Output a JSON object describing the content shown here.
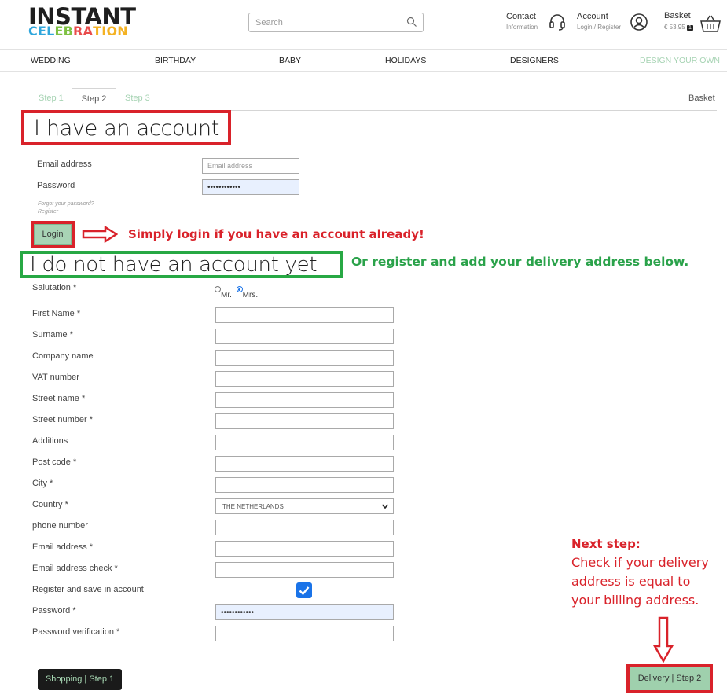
{
  "brand": {
    "line1": "INSTANT",
    "line2_letters": [
      {
        "ch": "C",
        "color": "#2fa6dc"
      },
      {
        "ch": "E",
        "color": "#2fa6dc"
      },
      {
        "ch": "L",
        "color": "#2fa6dc"
      },
      {
        "ch": "E",
        "color": "#7ec142"
      },
      {
        "ch": "B",
        "color": "#7ec142"
      },
      {
        "ch": "R",
        "color": "#e94b4b"
      },
      {
        "ch": "A",
        "color": "#e94b4b"
      },
      {
        "ch": "T",
        "color": "#f4b223"
      },
      {
        "ch": "I",
        "color": "#f4b223"
      },
      {
        "ch": "O",
        "color": "#f4b223"
      },
      {
        "ch": "N",
        "color": "#f4b223"
      }
    ]
  },
  "search": {
    "placeholder": "Search"
  },
  "header": {
    "contact_label": "Contact",
    "contact_sub": "Information",
    "account_label": "Account",
    "account_sub": "Login / Register",
    "basket_label": "Basket",
    "basket_amount": "€ 53,95",
    "basket_count": "1"
  },
  "nav": [
    "WEDDING",
    "BIRTHDAY",
    "BABY",
    "HOLIDAYS",
    "DESIGNERS",
    "DESIGN YOUR OWN"
  ],
  "steps": {
    "step1": "Step 1",
    "step2": "Step 2",
    "step3": "Step 3",
    "basket": "Basket"
  },
  "login_section": {
    "heading": "I have an account",
    "email_label": "Email address",
    "email_placeholder": "Email address",
    "password_label": "Password",
    "password_value": "••••••••••••",
    "forgot": "Forgot your password?",
    "register": "Register",
    "login_button": "Login"
  },
  "annotations": {
    "login_note": "Simply login if you have an account already!",
    "register_note": "Or register and add your delivery address below.",
    "next_head": "Next step:",
    "next_lines": [
      "Check if your delivery",
      "address is equal to",
      "your billing address."
    ]
  },
  "register_section": {
    "heading": "I do not have an account yet",
    "salutation_label": "Salutation *",
    "salutation_mr": "Mr.",
    "salutation_mrs": "Mrs.",
    "fields": [
      "First Name *",
      "Surname *",
      "Company name",
      "VAT number",
      "Street name *",
      "Street number *",
      "Additions",
      "Post code *",
      "City *"
    ],
    "country_label": "Country *",
    "country_value": "THE NETHERLANDS",
    "fields2": [
      "phone number",
      "Email address *",
      "Email address check *"
    ],
    "register_save_label": "Register and save in account",
    "password_label": "Password *",
    "password_value": "••••••••••••",
    "password_verify_label": "Password verification *"
  },
  "footer_buttons": {
    "back": "Shopping | Step 1",
    "next": "Delivery | Step 2"
  },
  "colors": {
    "accent_green": "#a8d4b5",
    "annotation_red": "#d9222a",
    "annotation_green": "#27a844",
    "checkbox_blue": "#1a73e8"
  }
}
